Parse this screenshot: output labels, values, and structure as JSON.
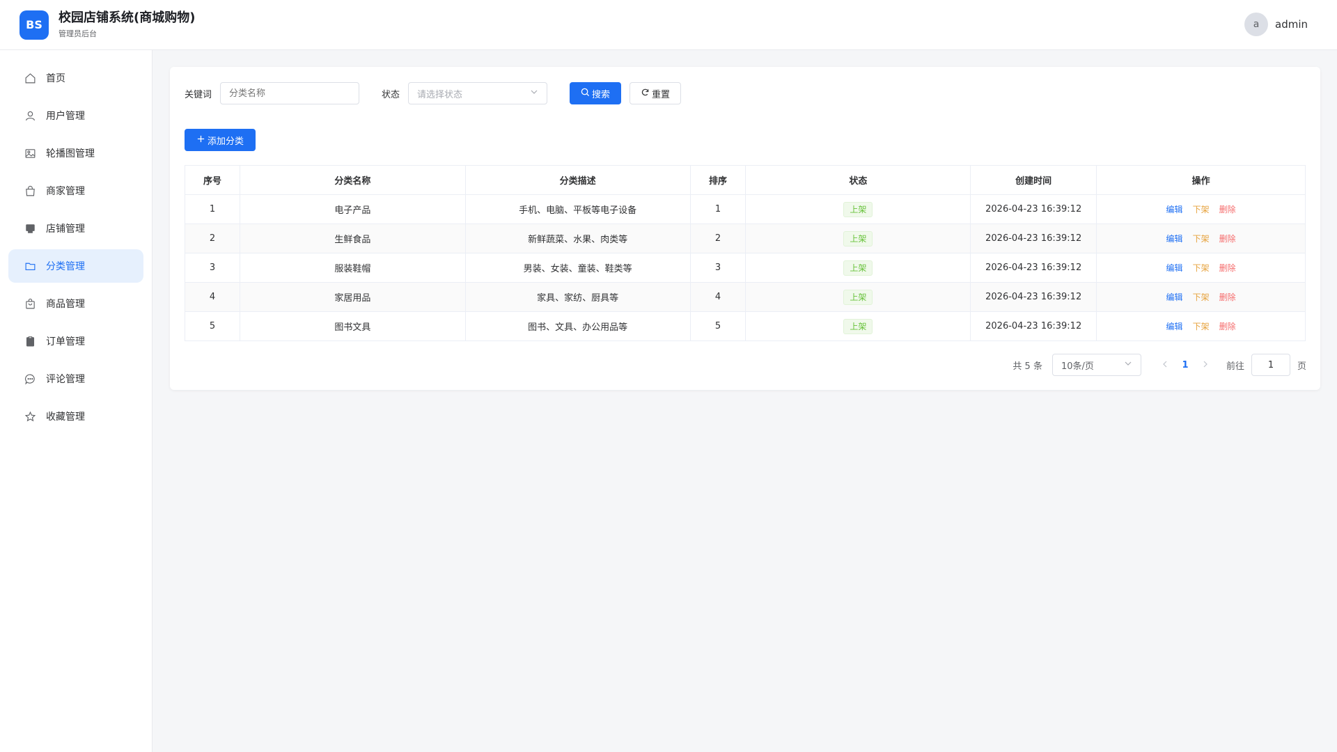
{
  "header": {
    "logo_text": "BS",
    "title": "校园店铺系统(商城购物)",
    "subtitle": "管理员后台",
    "avatar_letter": "a",
    "username": "admin"
  },
  "sidebar": {
    "items": [
      {
        "label": "首页",
        "icon": "home-icon"
      },
      {
        "label": "用户管理",
        "icon": "user-icon"
      },
      {
        "label": "轮播图管理",
        "icon": "image-icon"
      },
      {
        "label": "商家管理",
        "icon": "bag-icon"
      },
      {
        "label": "店铺管理",
        "icon": "shop-icon"
      },
      {
        "label": "分类管理",
        "icon": "folder-icon",
        "active": true
      },
      {
        "label": "商品管理",
        "icon": "goods-icon"
      },
      {
        "label": "订单管理",
        "icon": "order-icon"
      },
      {
        "label": "评论管理",
        "icon": "comment-icon"
      },
      {
        "label": "收藏管理",
        "icon": "star-icon"
      }
    ]
  },
  "filter": {
    "keyword_label": "关键词",
    "keyword_placeholder": "分类名称",
    "status_label": "状态",
    "status_placeholder": "请选择状态",
    "search_label": "搜索",
    "reset_label": "重置"
  },
  "add_label": "添加分类",
  "table": {
    "headers": [
      "序号",
      "分类名称",
      "分类描述",
      "排序",
      "状态",
      "创建时间",
      "操作"
    ],
    "rows": [
      {
        "index": "1",
        "name": "电子产品",
        "desc": "手机、电脑、平板等电子设备",
        "sort": "1",
        "status": "上架",
        "created": "2026-04-23 16:39:12"
      },
      {
        "index": "2",
        "name": "生鲜食品",
        "desc": "新鲜蔬菜、水果、肉类等",
        "sort": "2",
        "status": "上架",
        "created": "2026-04-23 16:39:12"
      },
      {
        "index": "3",
        "name": "服装鞋帽",
        "desc": "男装、女装、童装、鞋类等",
        "sort": "3",
        "status": "上架",
        "created": "2026-04-23 16:39:12"
      },
      {
        "index": "4",
        "name": "家居用品",
        "desc": "家具、家纺、厨具等",
        "sort": "4",
        "status": "上架",
        "created": "2026-04-23 16:39:12"
      },
      {
        "index": "5",
        "name": "图书文具",
        "desc": "图书、文具、办公用品等",
        "sort": "5",
        "status": "上架",
        "created": "2026-04-23 16:39:12"
      }
    ],
    "actions": {
      "edit": "编辑",
      "down": "下架",
      "delete": "删除"
    }
  },
  "pagination": {
    "total": "共 5 条",
    "page_size": "10条/页",
    "current": "1",
    "goto_label": "前往",
    "goto_value": "1",
    "page_suffix": "页"
  },
  "colors": {
    "primary": "#1e6ff3",
    "success": "#67c23a",
    "warning": "#e6a23c",
    "danger": "#f56c6c"
  }
}
